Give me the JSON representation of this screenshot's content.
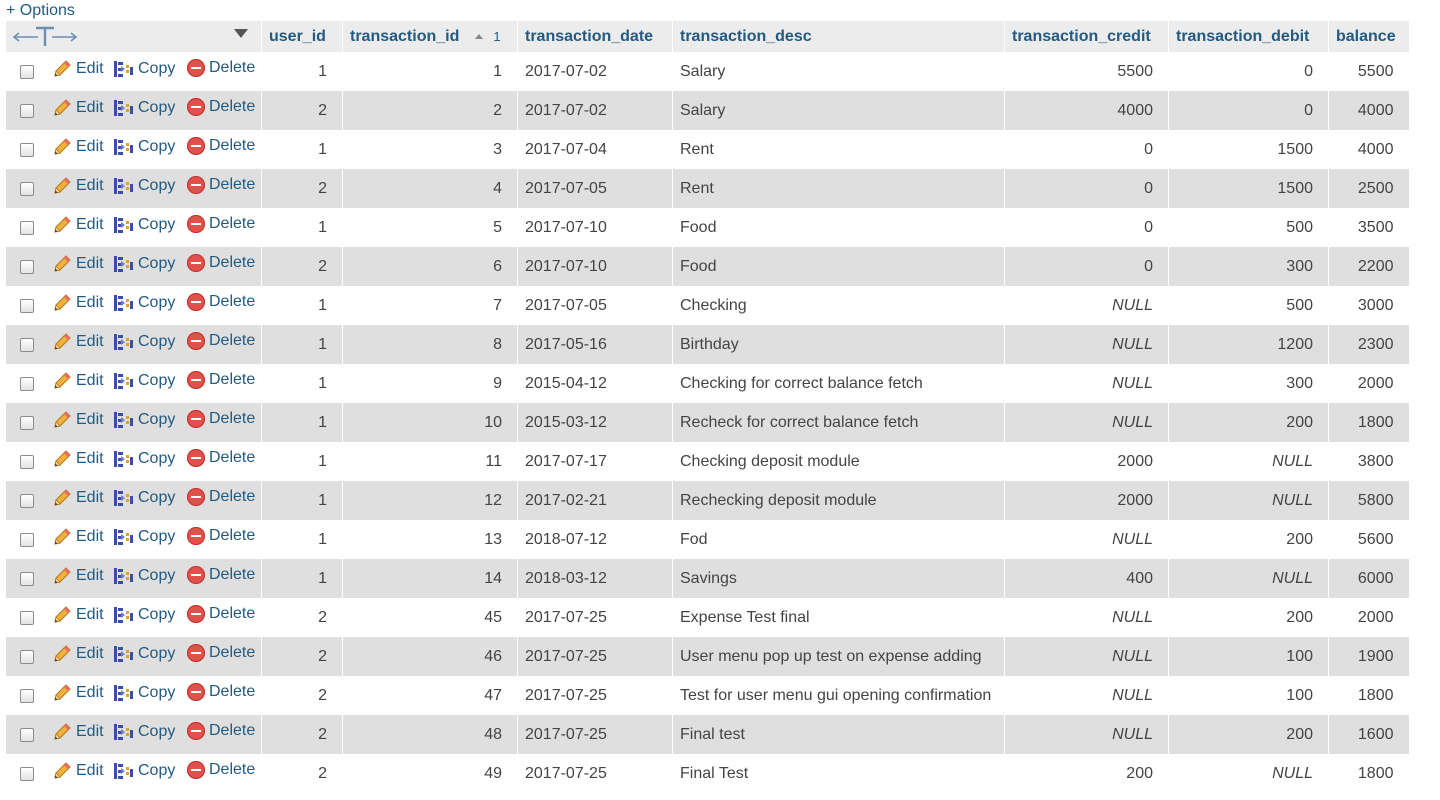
{
  "options_label": "+ Options",
  "actions": {
    "edit": "Edit",
    "copy": "Copy",
    "delete": "Delete"
  },
  "columns": [
    "user_id",
    "transaction_id",
    "transaction_date",
    "transaction_desc",
    "transaction_credit",
    "transaction_debit",
    "balance"
  ],
  "sort": {
    "column": "transaction_id",
    "direction": "asc",
    "order": "1"
  },
  "rows": [
    [
      "1",
      "1",
      "2017-07-02",
      "Salary",
      "5500",
      "0",
      "5500"
    ],
    [
      "2",
      "2",
      "2017-07-02",
      "Salary",
      "4000",
      "0",
      "4000"
    ],
    [
      "1",
      "3",
      "2017-07-04",
      "Rent",
      "0",
      "1500",
      "4000"
    ],
    [
      "2",
      "4",
      "2017-07-05",
      "Rent",
      "0",
      "1500",
      "2500"
    ],
    [
      "1",
      "5",
      "2017-07-10",
      "Food",
      "0",
      "500",
      "3500"
    ],
    [
      "2",
      "6",
      "2017-07-10",
      "Food",
      "0",
      "300",
      "2200"
    ],
    [
      "1",
      "7",
      "2017-07-05",
      "Checking",
      "NULL",
      "500",
      "3000"
    ],
    [
      "1",
      "8",
      "2017-05-16",
      "Birthday",
      "NULL",
      "1200",
      "2300"
    ],
    [
      "1",
      "9",
      "2015-04-12",
      "Checking for correct balance fetch",
      "NULL",
      "300",
      "2000"
    ],
    [
      "1",
      "10",
      "2015-03-12",
      "Recheck for correct balance fetch",
      "NULL",
      "200",
      "1800"
    ],
    [
      "1",
      "11",
      "2017-07-17",
      "Checking deposit module",
      "2000",
      "NULL",
      "3800"
    ],
    [
      "1",
      "12",
      "2017-02-21",
      "Rechecking deposit module",
      "2000",
      "NULL",
      "5800"
    ],
    [
      "1",
      "13",
      "2018-07-12",
      "Fod",
      "NULL",
      "200",
      "5600"
    ],
    [
      "1",
      "14",
      "2018-03-12",
      "Savings",
      "400",
      "NULL",
      "6000"
    ],
    [
      "2",
      "45",
      "2017-07-25",
      "Expense Test final",
      "NULL",
      "200",
      "2000"
    ],
    [
      "2",
      "46",
      "2017-07-25",
      "User menu pop up test on expense adding",
      "NULL",
      "100",
      "1900"
    ],
    [
      "2",
      "47",
      "2017-07-25",
      "Test for user menu gui opening confirmation",
      "NULL",
      "100",
      "1800"
    ],
    [
      "2",
      "48",
      "2017-07-25",
      "Final test",
      "NULL",
      "200",
      "1600"
    ],
    [
      "2",
      "49",
      "2017-07-25",
      "Final Test",
      "200",
      "NULL",
      "1800"
    ]
  ],
  "colors": {
    "link": "#235a81",
    "row_odd": "#ffffff",
    "row_even": "#dfdfdf",
    "header_bg": "#ececec",
    "delete_icon": "#e0514b"
  },
  "icons": {
    "edit": "pencil-icon",
    "copy": "copy-icon",
    "delete": "delete-icon",
    "column_arrows": "column-arrows-icon",
    "dropdown": "chevron-down-icon"
  }
}
